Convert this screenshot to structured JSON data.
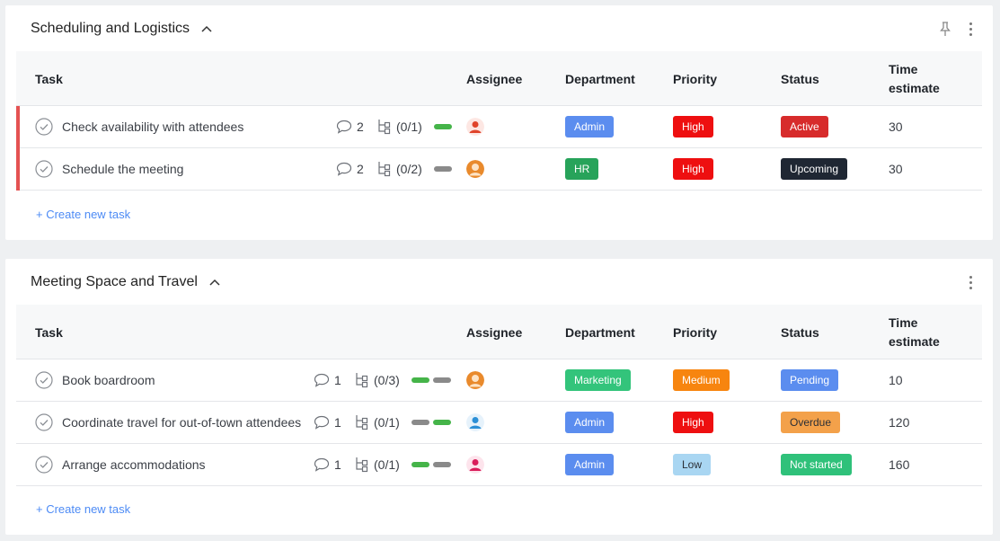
{
  "colors": {
    "admin": "#5b8def",
    "hr": "#27a35a",
    "marketing": "#33c47b",
    "high": "#ee0f10",
    "medium": "#f7850f",
    "low": "#a9d6f2",
    "active": "#d72b2b",
    "upcoming": "#1f2733",
    "pending": "#5b8def",
    "overdue": "#f3a14a",
    "not_started": "#2fc17a",
    "flag": "#e45252",
    "link": "#4d8bf5"
  },
  "columns": {
    "task": "Task",
    "assignee": "Assignee",
    "department": "Department",
    "priority": "Priority",
    "status": "Status",
    "time_estimate": "Time estimate"
  },
  "groups": [
    {
      "title": "Scheduling and Logistics",
      "create_label": "+ Create new task",
      "tasks": [
        {
          "name": "Check availability with attendees",
          "comments": "2",
          "subtasks": "(0/1)",
          "department": "Admin",
          "priority": "High",
          "status": "Active",
          "time": "30",
          "avatar": "avatar-red",
          "progress": [
            "green"
          ]
        },
        {
          "name": "Schedule the meeting",
          "comments": "2",
          "subtasks": "(0/2)",
          "department": "HR",
          "priority": "High",
          "status": "Upcoming",
          "time": "30",
          "avatar": "avatar-orange",
          "progress": [
            "grey"
          ]
        }
      ]
    },
    {
      "title": "Meeting Space and Travel",
      "create_label": "+ Create new task",
      "tasks": [
        {
          "name": "Book boardroom",
          "comments": "1",
          "subtasks": "(0/3)",
          "department": "Marketing",
          "priority": "Medium",
          "status": "Pending",
          "time": "10",
          "avatar": "avatar-orange",
          "progress": [
            "green",
            "grey"
          ]
        },
        {
          "name": "Coordinate travel for out-of-town attendees",
          "comments": "1",
          "subtasks": "(0/1)",
          "department": "Admin",
          "priority": "High",
          "status": "Overdue",
          "time": "120",
          "avatar": "avatar-blue",
          "progress": [
            "grey",
            "green"
          ]
        },
        {
          "name": "Arrange accommodations",
          "comments": "1",
          "subtasks": "(0/1)",
          "department": "Admin",
          "priority": "Low",
          "status": "Not started",
          "time": "160",
          "avatar": "avatar-pink",
          "progress": [
            "green",
            "grey"
          ]
        }
      ]
    }
  ]
}
